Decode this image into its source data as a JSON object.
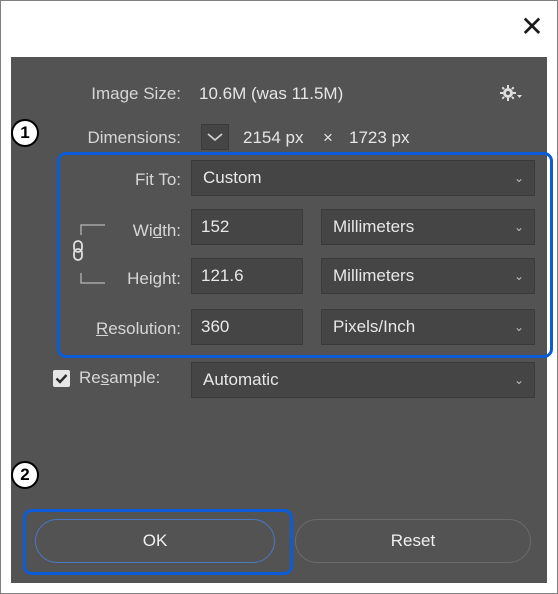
{
  "window": {
    "close_glyph": "✕"
  },
  "image_size": {
    "label": "Image Size:",
    "value": "10.6M (was 11.5M)"
  },
  "settings_icon": "gear-icon",
  "dimensions": {
    "label": "Dimensions:",
    "width": "2154 px",
    "times": "×",
    "height": "1723 px"
  },
  "fit_to": {
    "label": "Fit To:",
    "value": "Custom"
  },
  "width": {
    "label_pre": "Wi",
    "label_u": "d",
    "label_post": "th:",
    "value": "152",
    "unit": "Millimeters"
  },
  "height": {
    "label_pre": "Hei",
    "label_u": "g",
    "label_post": "ht:",
    "value": "121.6",
    "unit": "Millimeters"
  },
  "resolution": {
    "label_u": "R",
    "label_post": "esolution:",
    "value": "360",
    "unit": "Pixels/Inch"
  },
  "resample": {
    "label_pre": "Re",
    "label_u": "s",
    "label_post": "ample:",
    "checked": true,
    "value": "Automatic"
  },
  "buttons": {
    "ok": "OK",
    "reset": "Reset"
  },
  "callouts": {
    "one": "1",
    "two": "2"
  },
  "colors": {
    "highlight": "#0b5cd6",
    "panel": "#535353",
    "field": "#454545"
  }
}
